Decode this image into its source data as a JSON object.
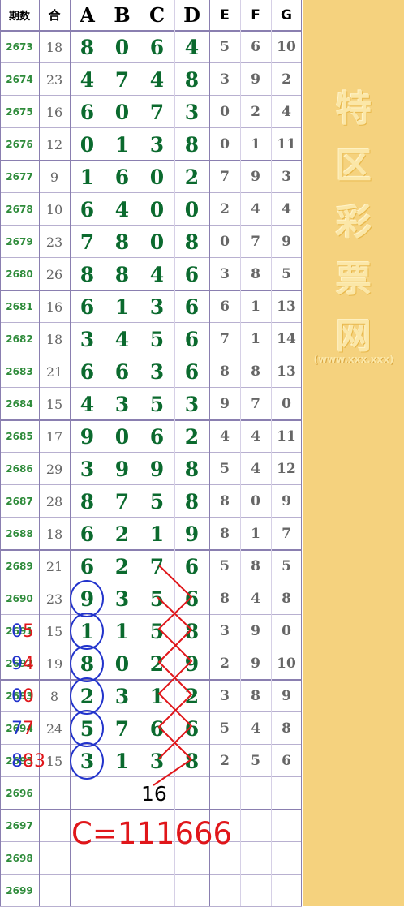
{
  "header": {
    "period": "期数",
    "sum": "合",
    "A": "A",
    "B": "B",
    "C": "C",
    "D": "D",
    "E": "E",
    "F": "F",
    "G": "G"
  },
  "rows": [
    {
      "p": "2673",
      "s": "18",
      "a": "8",
      "b": "0",
      "c": "6",
      "d": "4",
      "e": "5",
      "f": "6",
      "g": "10"
    },
    {
      "p": "2674",
      "s": "23",
      "a": "4",
      "b": "7",
      "c": "4",
      "d": "8",
      "e": "3",
      "f": "9",
      "g": "2"
    },
    {
      "p": "2675",
      "s": "16",
      "a": "6",
      "b": "0",
      "c": "7",
      "d": "3",
      "e": "0",
      "f": "2",
      "g": "4"
    },
    {
      "p": "2676",
      "s": "12",
      "a": "0",
      "b": "1",
      "c": "3",
      "d": "8",
      "e": "0",
      "f": "1",
      "g": "11"
    },
    {
      "p": "2677",
      "s": "9",
      "a": "1",
      "b": "6",
      "c": "0",
      "d": "2",
      "e": "7",
      "f": "9",
      "g": "3"
    },
    {
      "p": "2678",
      "s": "10",
      "a": "6",
      "b": "4",
      "c": "0",
      "d": "0",
      "e": "2",
      "f": "4",
      "g": "4"
    },
    {
      "p": "2679",
      "s": "23",
      "a": "7",
      "b": "8",
      "c": "0",
      "d": "8",
      "e": "0",
      "f": "7",
      "g": "9"
    },
    {
      "p": "2680",
      "s": "26",
      "a": "8",
      "b": "8",
      "c": "4",
      "d": "6",
      "e": "3",
      "f": "8",
      "g": "5"
    },
    {
      "p": "2681",
      "s": "16",
      "a": "6",
      "b": "1",
      "c": "3",
      "d": "6",
      "e": "6",
      "f": "1",
      "g": "13"
    },
    {
      "p": "2682",
      "s": "18",
      "a": "3",
      "b": "4",
      "c": "5",
      "d": "6",
      "e": "7",
      "f": "1",
      "g": "14"
    },
    {
      "p": "2683",
      "s": "21",
      "a": "6",
      "b": "6",
      "c": "3",
      "d": "6",
      "e": "8",
      "f": "8",
      "g": "13"
    },
    {
      "p": "2684",
      "s": "15",
      "a": "4",
      "b": "3",
      "c": "5",
      "d": "3",
      "e": "9",
      "f": "7",
      "g": "0"
    },
    {
      "p": "2685",
      "s": "17",
      "a": "9",
      "b": "0",
      "c": "6",
      "d": "2",
      "e": "4",
      "f": "4",
      "g": "11"
    },
    {
      "p": "2686",
      "s": "29",
      "a": "3",
      "b": "9",
      "c": "9",
      "d": "8",
      "e": "5",
      "f": "4",
      "g": "12"
    },
    {
      "p": "2687",
      "s": "28",
      "a": "8",
      "b": "7",
      "c": "5",
      "d": "8",
      "e": "8",
      "f": "0",
      "g": "9"
    },
    {
      "p": "2688",
      "s": "18",
      "a": "6",
      "b": "2",
      "c": "1",
      "d": "9",
      "e": "8",
      "f": "1",
      "g": "7"
    },
    {
      "p": "2689",
      "s": "21",
      "a": "6",
      "b": "2",
      "c": "7",
      "d": "6",
      "e": "5",
      "f": "8",
      "g": "5"
    },
    {
      "p": "2690",
      "s": "23",
      "a": "9",
      "b": "3",
      "c": "5",
      "d": "6",
      "e": "8",
      "f": "4",
      "g": "8"
    },
    {
      "p": "2691",
      "s": "15",
      "a": "1",
      "b": "1",
      "c": "5",
      "d": "8",
      "e": "3",
      "f": "9",
      "g": "0"
    },
    {
      "p": "2692",
      "s": "19",
      "a": "8",
      "b": "0",
      "c": "2",
      "d": "9",
      "e": "2",
      "f": "9",
      "g": "10"
    },
    {
      "p": "2693",
      "s": "8",
      "a": "2",
      "b": "3",
      "c": "1",
      "d": "2",
      "e": "3",
      "f": "8",
      "g": "9"
    },
    {
      "p": "2694",
      "s": "24",
      "a": "5",
      "b": "7",
      "c": "6",
      "d": "6",
      "e": "5",
      "f": "4",
      "g": "8"
    },
    {
      "p": "2695",
      "s": "15",
      "a": "3",
      "b": "1",
      "c": "3",
      "d": "8",
      "e": "2",
      "f": "5",
      "g": "6"
    },
    {
      "p": "2696",
      "s": "",
      "a": "",
      "b": "",
      "c": "",
      "d": "",
      "e": "",
      "f": "",
      "g": ""
    },
    {
      "p": "2697",
      "s": "",
      "a": "",
      "b": "",
      "c": "",
      "d": "",
      "e": "",
      "f": "",
      "g": ""
    },
    {
      "p": "2698",
      "s": "",
      "a": "",
      "b": "",
      "c": "",
      "d": "",
      "e": "",
      "f": "",
      "g": ""
    },
    {
      "p": "2699",
      "s": "",
      "a": "",
      "b": "",
      "c": "",
      "d": "",
      "e": "",
      "f": "",
      "g": ""
    }
  ],
  "sidebar": {
    "chars": [
      "特",
      "区",
      "彩",
      "票",
      "网"
    ],
    "url": "(www.xxx.xxx)"
  },
  "annotations": {
    "left_pairs": [
      {
        "blue": "0",
        "red": "5"
      },
      {
        "blue": "9",
        "red": "4"
      },
      {
        "blue": "0",
        "red": "0"
      },
      {
        "blue": "7",
        "red": "7"
      },
      {
        "blue": "8",
        "red": "83"
      }
    ],
    "count": "16",
    "formula": "C=111666"
  },
  "colors": {
    "digit": "#0b6a2e",
    "period": "#2e8b3a",
    "muted": "#666666",
    "grid": "#8a7fb0",
    "sidebar": "#f5d27e",
    "red": "#e0161a",
    "blue": "#2233cc"
  }
}
